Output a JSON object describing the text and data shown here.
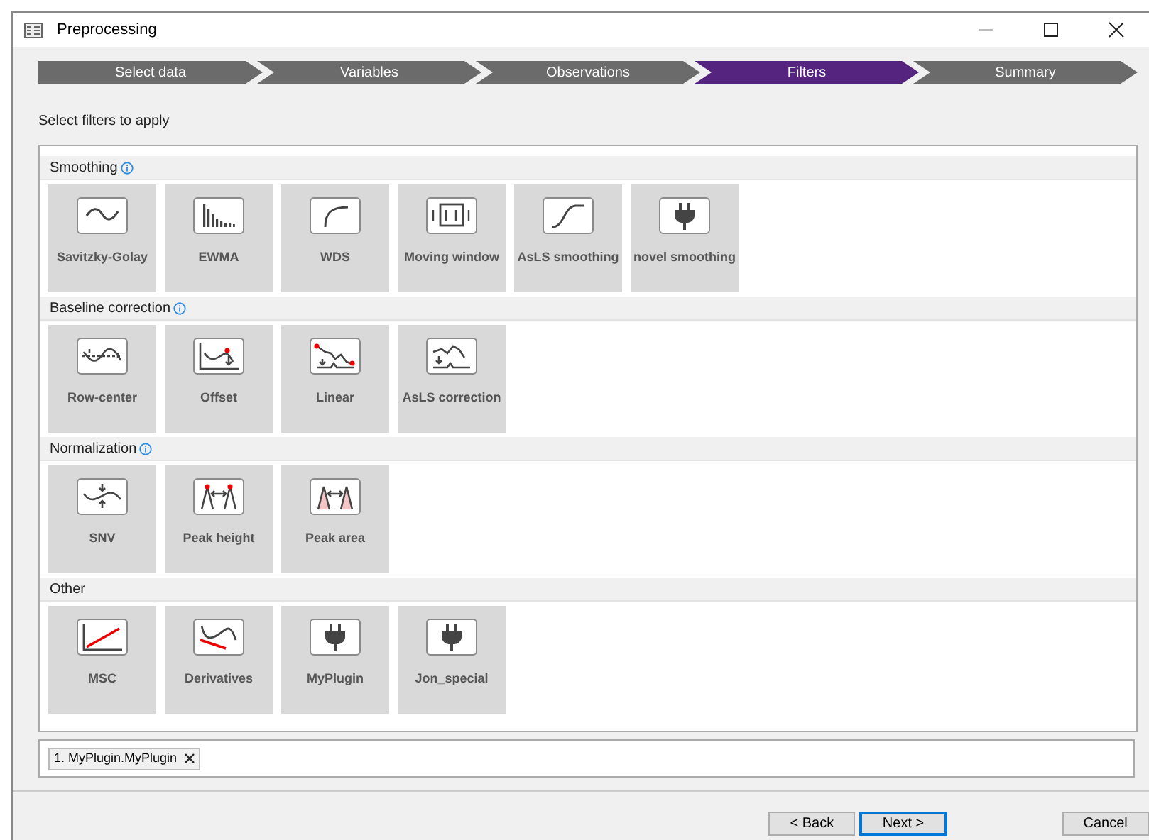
{
  "window": {
    "title": "Preprocessing"
  },
  "steps": [
    {
      "label": "Select data",
      "selected": false
    },
    {
      "label": "Variables",
      "selected": false
    },
    {
      "label": "Observations",
      "selected": false
    },
    {
      "label": "Filters",
      "selected": true
    },
    {
      "label": "Summary",
      "selected": false
    }
  ],
  "instruction": "Select filters to apply",
  "groups": [
    {
      "title": "Smoothing",
      "info": true,
      "filters": [
        {
          "label": "Savitzky-Golay",
          "kind": "wave"
        },
        {
          "label": "EWMA",
          "kind": "bars"
        },
        {
          "label": "WDS",
          "kind": "curve"
        },
        {
          "label": "Moving window",
          "kind": "window"
        },
        {
          "label": "AsLS smoothing",
          "kind": "sigmoid"
        },
        {
          "label": "novel smoothing",
          "kind": "plug"
        }
      ]
    },
    {
      "title": "Baseline correction",
      "info": true,
      "filters": [
        {
          "label": "Row-center",
          "kind": "rowcenter"
        },
        {
          "label": "Offset",
          "kind": "offset"
        },
        {
          "label": "Linear",
          "kind": "linear"
        },
        {
          "label": "AsLS correction",
          "kind": "aslsbase"
        }
      ]
    },
    {
      "title": "Normalization",
      "info": true,
      "filters": [
        {
          "label": "SNV",
          "kind": "snv"
        },
        {
          "label": "Peak height",
          "kind": "peakheight"
        },
        {
          "label": "Peak area",
          "kind": "peakarea"
        }
      ]
    },
    {
      "title": "Other",
      "info": false,
      "filters": [
        {
          "label": "MSC",
          "kind": "msc"
        },
        {
          "label": "Derivatives",
          "kind": "deriv"
        },
        {
          "label": "MyPlugin",
          "kind": "plug"
        },
        {
          "label": "Jon_special",
          "kind": "plug"
        }
      ]
    }
  ],
  "selected_filters": [
    {
      "label": "1. MyPlugin.MyPlugin"
    }
  ],
  "buttons": [
    {
      "label": "< Back",
      "kind": "normal"
    },
    {
      "label": "Next >",
      "kind": "default"
    },
    {
      "label": "Cancel",
      "kind": "cancel"
    }
  ]
}
